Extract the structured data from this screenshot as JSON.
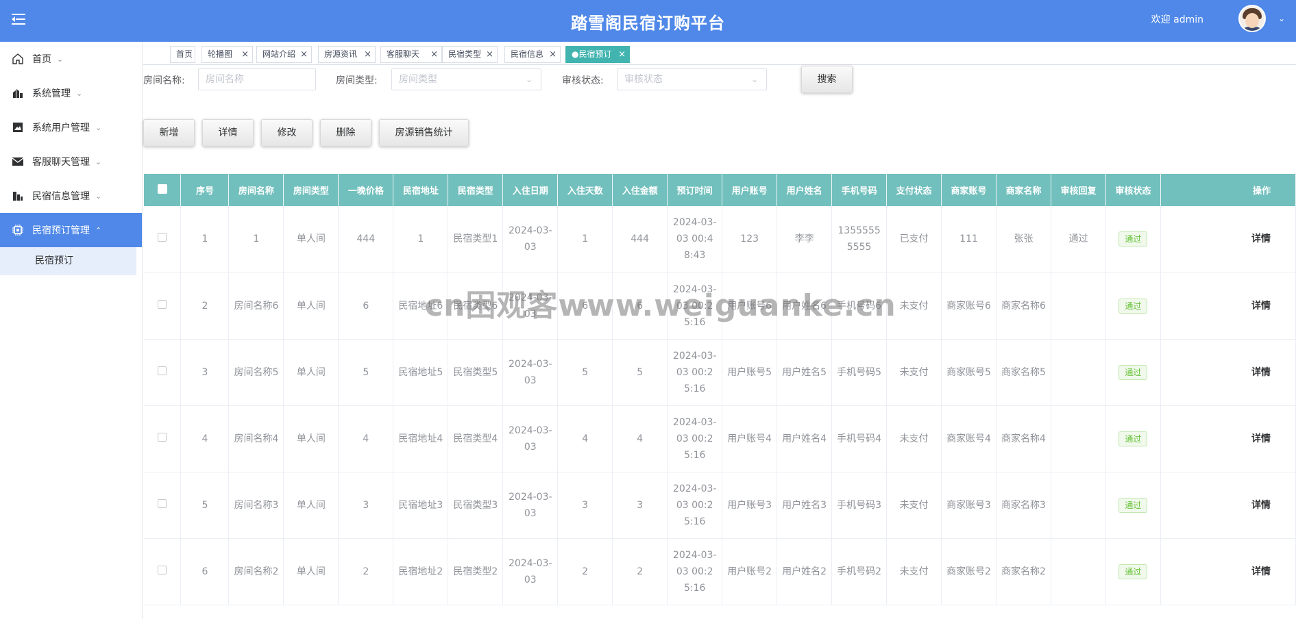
{
  "header": {
    "title": "踏雪阁民宿订购平台",
    "welcome": "欢迎 admin"
  },
  "sidebar": {
    "items": [
      {
        "label": "首页",
        "icon": "home-icon"
      },
      {
        "label": "系统管理",
        "icon": "chart-icon"
      },
      {
        "label": "系统用户管理",
        "icon": "image-icon"
      },
      {
        "label": "客服聊天管理",
        "icon": "mail-icon"
      },
      {
        "label": "民宿信息管理",
        "icon": "building-icon"
      },
      {
        "label": "民宿预订管理",
        "icon": "cpu-icon"
      }
    ],
    "sub_item": "民宿预订"
  },
  "tabs": [
    "首页",
    "轮播图",
    "网站介绍",
    "房源资讯",
    "客服聊天",
    "民宿类型",
    "民宿信息",
    "●民宿预订"
  ],
  "search": {
    "room_name_label": "房间名称:",
    "room_name_placeholder": "房间名称",
    "room_type_label": "房间类型:",
    "room_type_placeholder": "房间类型",
    "audit_label": "审核状态:",
    "audit_placeholder": "审核状态",
    "search_button": "搜索"
  },
  "actions": [
    "新增",
    "详情",
    "修改",
    "删除",
    "房源销售统计"
  ],
  "table": {
    "headers": [
      "序号",
      "房间名称",
      "房间类型",
      "一晚价格",
      "民宿地址",
      "民宿类型",
      "入住日期",
      "入住天数",
      "入住金额",
      "预订时间",
      "用户账号",
      "用户姓名",
      "手机号码",
      "支付状态",
      "商家账号",
      "商家名称",
      "审核回复",
      "审核状态",
      "操作"
    ],
    "rows": [
      [
        "1",
        "1",
        "单人间",
        "444",
        "1",
        "民宿类型1",
        "2024-03-03",
        "1",
        "444",
        "2024-03-03 00:48:43",
        "123",
        "李李",
        "13555555555",
        "已支付",
        "111",
        "张张",
        "通过",
        "通过",
        "详情"
      ],
      [
        "2",
        "房间名称6",
        "单人间",
        "6",
        "民宿地址6",
        "民宿类型6",
        "2024-03-03",
        "6",
        "6",
        "2024-03-03 00:25:16",
        "用户账号6",
        "用户姓名6",
        "手机号码6",
        "未支付",
        "商家账号6",
        "商家名称6",
        "",
        "通过",
        "详情"
      ],
      [
        "3",
        "房间名称5",
        "单人间",
        "5",
        "民宿地址5",
        "民宿类型5",
        "2024-03-03",
        "5",
        "5",
        "2024-03-03 00:25:16",
        "用户账号5",
        "用户姓名5",
        "手机号码5",
        "未支付",
        "商家账号5",
        "商家名称5",
        "",
        "通过",
        "详情"
      ],
      [
        "4",
        "房间名称4",
        "单人间",
        "4",
        "民宿地址4",
        "民宿类型4",
        "2024-03-03",
        "4",
        "4",
        "2024-03-03 00:25:16",
        "用户账号4",
        "用户姓名4",
        "手机号码4",
        "未支付",
        "商家账号4",
        "商家名称4",
        "",
        "通过",
        "详情"
      ],
      [
        "5",
        "房间名称3",
        "单人间",
        "3",
        "民宿地址3",
        "民宿类型3",
        "2024-03-03",
        "3",
        "3",
        "2024-03-03 00:25:16",
        "用户账号3",
        "用户姓名3",
        "手机号码3",
        "未支付",
        "商家账号3",
        "商家名称3",
        "",
        "通过",
        "详情"
      ],
      [
        "6",
        "房间名称2",
        "单人间",
        "2",
        "民宿地址2",
        "民宿类型2",
        "2024-03-03",
        "2",
        "2",
        "2024-03-03 00:25:16",
        "用户账号2",
        "用户姓名2",
        "手机号码2",
        "未支付",
        "商家账号2",
        "商家名称2",
        "",
        "通过",
        "详情"
      ]
    ]
  },
  "watermark": "cn困观客www.weiguanke.cn",
  "colors": {
    "header_bg": "#4f88e8",
    "table_header_bg": "#72c0bd",
    "active_tab_bg": "#42b4b0",
    "status_green": "#67c23a"
  }
}
